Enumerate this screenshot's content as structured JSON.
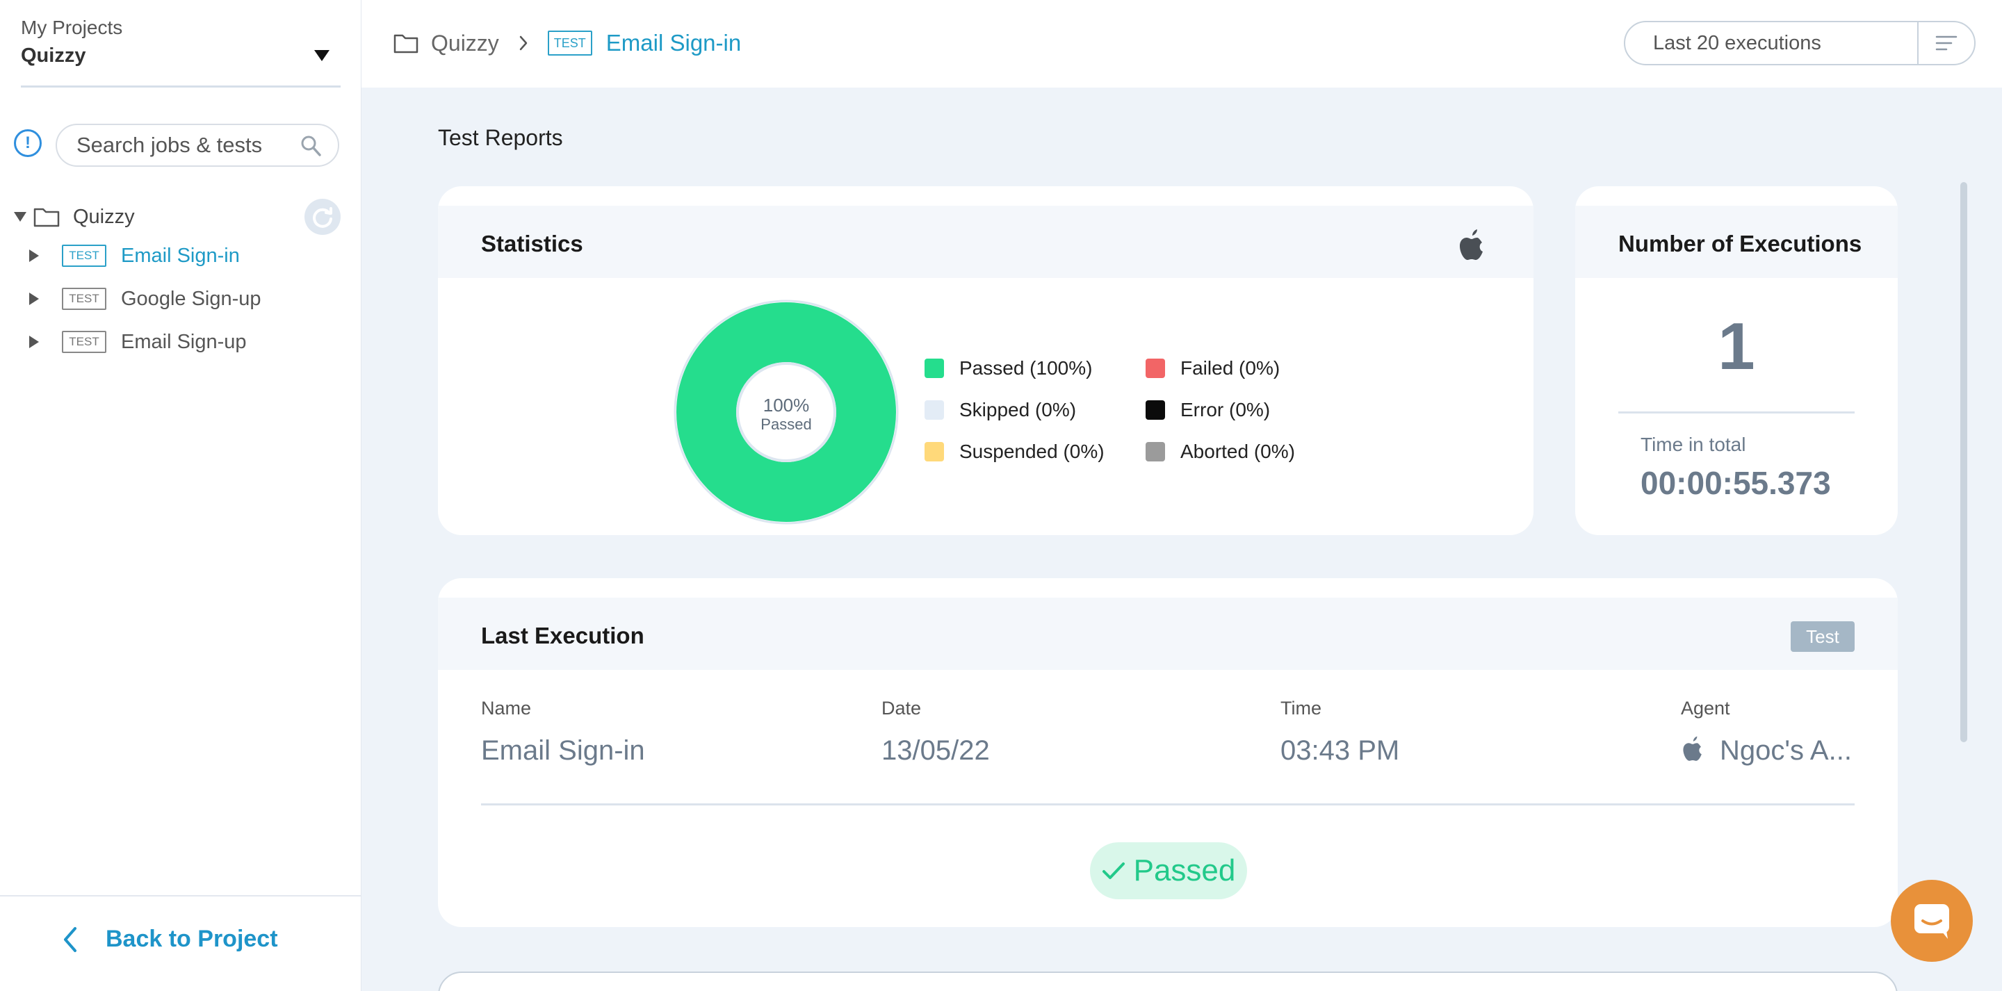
{
  "sidebar": {
    "project_caption": "My Projects",
    "project_name": "Quizzy",
    "search_placeholder": "Search jobs & tests",
    "tree": {
      "root_label": "Quizzy",
      "items": [
        {
          "badge": "TEST",
          "label": "Email Sign-in",
          "active": true
        },
        {
          "badge": "TEST",
          "label": "Google Sign-up",
          "active": false
        },
        {
          "badge": "TEST",
          "label": "Email Sign-up",
          "active": false
        }
      ]
    },
    "back_label": "Back to Project"
  },
  "breadcrumb": {
    "project": "Quizzy",
    "badge": "TEST",
    "current": "Email Sign-in"
  },
  "executions_filter": {
    "label": "Last 20 executions"
  },
  "page_title": "Test Reports",
  "statistics": {
    "title": "Statistics",
    "donut_percent": "100%",
    "donut_caption": "Passed",
    "passed_fraction": 1.0,
    "legend": [
      {
        "label": "Passed (100%)",
        "color": "#25dd8d"
      },
      {
        "label": "Failed (0%)",
        "color": "#f26566"
      },
      {
        "label": "Skipped (0%)",
        "color": "#e3ecf6"
      },
      {
        "label": "Error (0%)",
        "color": "#0b0b0b"
      },
      {
        "label": "Suspended (0%)",
        "color": "#ffd97a"
      },
      {
        "label": "Aborted (0%)",
        "color": "#9b9b9b"
      }
    ]
  },
  "executions": {
    "title": "Number of Executions",
    "count": "1",
    "time_caption": "Time in total",
    "time_value": "00:00:55.373"
  },
  "last_execution": {
    "title": "Last Execution",
    "tag": "Test",
    "columns": {
      "name_caption": "Name",
      "name_value": "Email Sign-in",
      "date_caption": "Date",
      "date_value": "13/05/22",
      "time_caption": "Time",
      "time_value": "03:43 PM",
      "agent_caption": "Agent",
      "agent_value": "Ngoc's A..."
    },
    "status": "Passed"
  },
  "colors": {
    "accent": "#1e9ac6",
    "passed": "#25dd8d",
    "chat": "#e8913a"
  }
}
